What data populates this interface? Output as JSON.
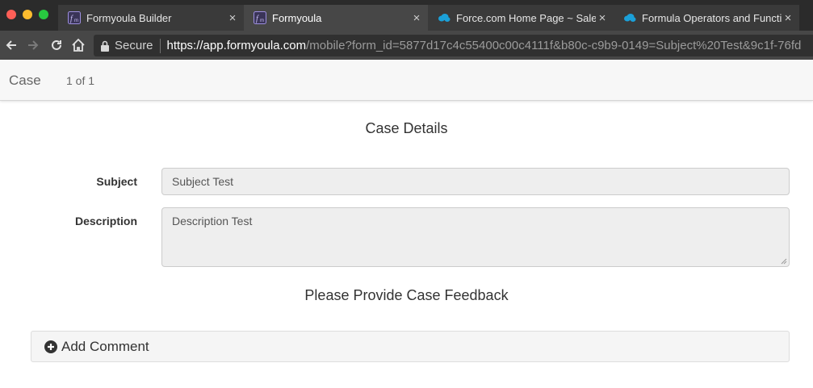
{
  "browser": {
    "tabs": [
      {
        "title": "Formyoula Builder",
        "icon": "formyoula-logo-icon",
        "active": false
      },
      {
        "title": "Formyoula",
        "icon": "formyoula-logo-icon",
        "active": true
      },
      {
        "title": "Force.com Home Page ~ Salesf",
        "icon": "salesforce-cloud-icon",
        "active": false
      },
      {
        "title": "Formula Operators and Functio",
        "icon": "salesforce-cloud-icon",
        "active": false
      }
    ],
    "close_glyph": "×",
    "address": {
      "security_label": "Secure",
      "host": "https://app.formyoula.com",
      "path": "/mobile?form_id=5877d17c4c55400c00c4111f&b80c-c9b9-0149=Subject%20Test&9c1f-76fd"
    }
  },
  "header": {
    "object_name": "Case",
    "record_count": "1 of 1"
  },
  "form": {
    "section1_title": "Case Details",
    "subject": {
      "label": "Subject",
      "value": "Subject Test"
    },
    "description": {
      "label": "Description",
      "value": "Description Test"
    },
    "section2_title": "Please Provide Case Feedback",
    "add_comment_label": "Add Comment"
  },
  "colors": {
    "tabstrip": "#2b2b2b",
    "toolbar": "#474747",
    "field_bg": "#eeeeee",
    "salesforce_blue": "#1ba0d8",
    "formyoula_purple": "#7b6cc4"
  }
}
